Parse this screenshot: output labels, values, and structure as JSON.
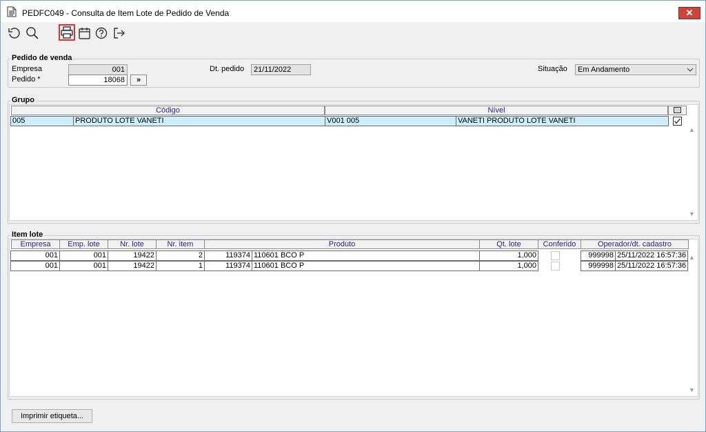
{
  "window": {
    "title": "PEDFC049 - Consulta de Item Lote de Pedido de Venda",
    "close_label": "✕"
  },
  "toolbar": {
    "icons": [
      "refresh-icon",
      "search-icon",
      "print-icon",
      "calendar-icon",
      "help-icon",
      "exit-icon"
    ]
  },
  "pedido": {
    "legend": "Pedido de venda",
    "empresa_label": "Empresa",
    "empresa_value": "001",
    "pedido_label": "Pedido *",
    "pedido_value": "18068",
    "goto_label": "»",
    "dt_pedido_label": "Dt. pedido",
    "dt_pedido_value": "21/11/2022",
    "situacao_label": "Situação",
    "situacao_value": "Em Andamento"
  },
  "grupo": {
    "legend": "Grupo",
    "headers": {
      "codigo": "Código",
      "nivel": "Nível"
    },
    "rows": [
      {
        "cod": "005",
        "desc": "PRODUTO LOTE VANETI",
        "nivel_cod": "V001 005",
        "nivel_desc": "VANETI PRODUTO LOTE VANETI",
        "checked": true
      }
    ]
  },
  "item_lote": {
    "legend": "Item lote",
    "headers": {
      "empresa": "Empresa",
      "emp_lote": "Emp. lote",
      "nr_lote": "Nr. lote",
      "nr_item": "Nr. item",
      "produto": "Produto",
      "qt_lote": "Qt. lote",
      "conferido": "Conferido",
      "operador": "Operador/dt. cadastro"
    },
    "rows": [
      {
        "empresa": "001",
        "emp_lote": "001",
        "nr_lote": "19422",
        "nr_item": "2",
        "prod_cod": "119374",
        "prod_desc": "110601 BCO P",
        "qt_lote": "1,000",
        "conferido": false,
        "operador": "999998",
        "dt_cadastro": "25/11/2022 16:57:36"
      },
      {
        "empresa": "001",
        "emp_lote": "001",
        "nr_lote": "19422",
        "nr_item": "1",
        "prod_cod": "119374",
        "prod_desc": "110601 BCO P",
        "qt_lote": "1,000",
        "conferido": false,
        "operador": "999998",
        "dt_cadastro": "25/11/2022 16:57:36"
      }
    ]
  },
  "footer": {
    "imprimir_label": "Imprimir etiqueta..."
  }
}
